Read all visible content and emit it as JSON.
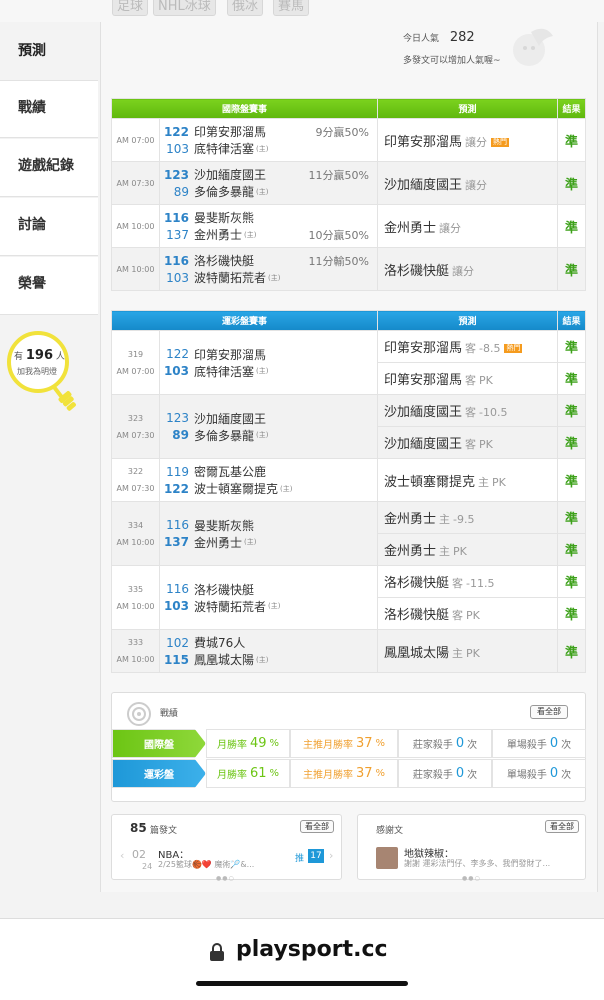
{
  "top_categories": [
    "足球",
    "NHL冰球",
    "俄冰",
    "賽馬"
  ],
  "sidebar": {
    "items": [
      {
        "label": "預測",
        "active": true
      },
      {
        "label": "戰績"
      },
      {
        "label": "遊戲紀錄"
      },
      {
        "label": "討論"
      },
      {
        "label": "榮譽"
      }
    ],
    "fans": {
      "prefix": "有",
      "count": "196",
      "suffix": "人",
      "cta": "加我為明燈"
    }
  },
  "popularity": {
    "label": "今日人氣",
    "count": "282",
    "hint": "多發文可以增加人氣喔~"
  },
  "intl_table": {
    "header": {
      "games": "國際盤賽事",
      "prediction": "預測",
      "result": "結果"
    },
    "rows": [
      {
        "time": "AM 07:00",
        "away_num": "122",
        "away": "印第安那溜馬",
        "home_num": "103",
        "home": "底特律活塞",
        "home_tag": "(主)",
        "odds": "9分贏50%",
        "odds_row": "away",
        "pick": "印第安那溜馬",
        "pick_tag": "讓分",
        "hot": "熱門",
        "result": "準"
      },
      {
        "time": "AM 07:30",
        "away_num": "123",
        "away": "沙加緬度國王",
        "home_num": "89",
        "home": "多倫多暴龍",
        "home_tag": "(主)",
        "odds": "11分贏50%",
        "odds_row": "away",
        "pick": "沙加緬度國王",
        "pick_tag": "讓分",
        "result": "準"
      },
      {
        "time": "AM 10:00",
        "away_num": "116",
        "away": "曼斐斯灰熊",
        "home_num": "137",
        "home": "金州勇士",
        "home_tag": "(主)",
        "odds": "10分贏50%",
        "odds_row": "home",
        "pick": "金州勇士",
        "pick_tag": "讓分",
        "result": "準"
      },
      {
        "time": "AM 10:00",
        "away_num": "116",
        "away": "洛杉磯快艇",
        "home_num": "103",
        "home": "波特蘭拓荒者",
        "home_tag": "(主)",
        "odds": "11分輸50%",
        "odds_row": "away",
        "pick": "洛杉磯快艇",
        "pick_tag": "讓分",
        "result": "準"
      }
    ]
  },
  "lottery_table": {
    "header": {
      "games": "運彩盤賽事",
      "prediction": "預測",
      "result": "結果"
    },
    "games": [
      {
        "id": "319",
        "time": "AM 07:00",
        "away_num": "122",
        "away": "印第安那溜馬",
        "home_num": "103",
        "home": "底特律活塞",
        "home_tag": "(主)",
        "picks": [
          {
            "team": "印第安那溜馬",
            "side": "客",
            "line": "-8.5",
            "hot": "熱門",
            "result": "準"
          },
          {
            "team": "印第安那溜馬",
            "side": "客",
            "line": "PK",
            "result": "準"
          }
        ]
      },
      {
        "id": "323",
        "time": "AM 07:30",
        "away_num": "123",
        "away": "沙加緬度國王",
        "home_num": "89",
        "home": "多倫多暴龍",
        "home_tag": "(主)",
        "picks": [
          {
            "team": "沙加緬度國王",
            "side": "客",
            "line": "-10.5",
            "result": "準"
          },
          {
            "team": "沙加緬度國王",
            "side": "客",
            "line": "PK",
            "result": "準"
          }
        ]
      },
      {
        "id": "322",
        "time": "AM 07:30",
        "away_num": "119",
        "away": "密爾瓦基公鹿",
        "home_num": "122",
        "home": "波士頓塞爾提克",
        "home_tag": "(主)",
        "picks": [
          {
            "team": "波士頓塞爾提克",
            "side": "主",
            "line": "PK",
            "result": "準"
          }
        ]
      },
      {
        "id": "334",
        "time": "AM 10:00",
        "away_num": "116",
        "away": "曼斐斯灰熊",
        "home_num": "137",
        "home": "金州勇士",
        "home_tag": "(主)",
        "picks": [
          {
            "team": "金州勇士",
            "side": "主",
            "line": "-9.5",
            "result": "準"
          },
          {
            "team": "金州勇士",
            "side": "主",
            "line": "PK",
            "result": "準"
          }
        ]
      },
      {
        "id": "335",
        "time": "AM 10:00",
        "away_num": "116",
        "away": "洛杉磯快艇",
        "home_num": "103",
        "home": "波特蘭拓荒者",
        "home_tag": "(主)",
        "picks": [
          {
            "team": "洛杉磯快艇",
            "side": "客",
            "line": "-11.5",
            "result": "準"
          },
          {
            "team": "洛杉磯快艇",
            "side": "客",
            "line": "PK",
            "result": "準"
          }
        ]
      },
      {
        "id": "333",
        "time": "AM 10:00",
        "away_num": "102",
        "away": "費城76人",
        "home_num": "115",
        "home": "鳳凰城太陽",
        "home_tag": "(主)",
        "picks": [
          {
            "team": "鳳凰城太陽",
            "side": "主",
            "line": "PK",
            "result": "準"
          }
        ]
      }
    ]
  },
  "record": {
    "title": "戰績",
    "view_all": "看全部",
    "rows": [
      {
        "label": "國際盤",
        "month_label": "月勝率",
        "month_val": "49",
        "month_unit": "%",
        "main_label": "主推月勝率",
        "main_val": "37",
        "main_unit": "%",
        "banker_label": "莊家殺手",
        "banker_val": "0",
        "banker_unit": "次",
        "single_label": "單場殺手",
        "single_val": "0",
        "single_unit": "次"
      },
      {
        "label": "運彩盤",
        "month_label": "月勝率",
        "month_val": "61",
        "month_unit": "%",
        "main_label": "主推月勝率",
        "main_val": "37",
        "main_unit": "%",
        "banker_label": "莊家殺手",
        "banker_val": "0",
        "banker_unit": "次",
        "single_label": "單場殺手",
        "single_val": "0",
        "single_unit": "次"
      }
    ]
  },
  "articles": {
    "count": "85",
    "title": "篇發文",
    "view_all": "看全部",
    "date_month": "02",
    "date_day": "24",
    "post_title": "NBA：",
    "post_snippet": "2/25籃球🏀❤️ 魔術🏸&...",
    "push_label": "推",
    "push_count": "17"
  },
  "thanks": {
    "title": "感謝文",
    "view_all": "看全部",
    "user": "地獄辣椒：",
    "snippet": "謝謝 運彩法門仔、李多多、我們發財了..."
  },
  "browser": {
    "domain": "playsport.cc"
  },
  "colors": {
    "intl_green": "#6cc514",
    "lottery_blue": "#1e98d8",
    "win_green": "#3da11a",
    "link_blue": "#2d83c7",
    "hot_orange": "#f59b1e",
    "pct_orange": "#f0a030"
  }
}
